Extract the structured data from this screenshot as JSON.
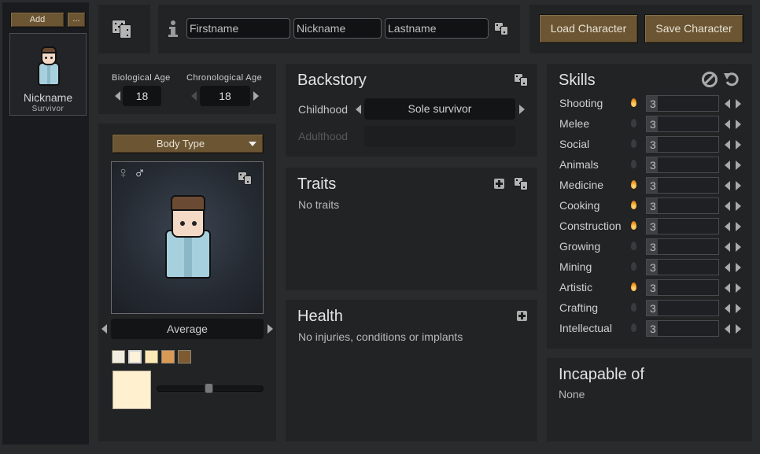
{
  "sidebar": {
    "add_label": "Add",
    "more_label": "...",
    "pawn": {
      "nickname": "Nickname",
      "title": "Survivor"
    }
  },
  "name": {
    "first_placeholder": "Firstname",
    "nick_placeholder": "Nickname",
    "last_placeholder": "Lastname"
  },
  "io": {
    "load_label": "Load Character",
    "save_label": "Save Character"
  },
  "age": {
    "biological_label": "Biological Age",
    "biological_value": "18",
    "chronological_label": "Chronological Age",
    "chronological_value": "18"
  },
  "appearance": {
    "body_type_label": "Body Type",
    "gender_female": "♀",
    "gender_male": "♂",
    "hair_style": "Average",
    "skin_swatches": [
      "#f1ece0",
      "#fdf1d9",
      "#fde9b6",
      "#d99a55",
      "#7e5a33"
    ],
    "selected_swatch": 1,
    "skin_color": "#fff0cf",
    "skin_slider_fraction": 0.48
  },
  "backstory": {
    "title": "Backstory",
    "childhood_label": "Childhood",
    "childhood_value": "Sole survivor",
    "adulthood_label": "Adulthood",
    "adulthood_value": ""
  },
  "traits": {
    "title": "Traits",
    "empty_text": "No traits"
  },
  "health": {
    "title": "Health",
    "empty_text": "No injuries, conditions or implants"
  },
  "skills": {
    "title": "Skills",
    "max_level": 20,
    "items": [
      {
        "name": "Shooting",
        "level": "3",
        "passion": true
      },
      {
        "name": "Melee",
        "level": "3",
        "passion": false
      },
      {
        "name": "Social",
        "level": "3",
        "passion": false
      },
      {
        "name": "Animals",
        "level": "3",
        "passion": false
      },
      {
        "name": "Medicine",
        "level": "3",
        "passion": true
      },
      {
        "name": "Cooking",
        "level": "3",
        "passion": true
      },
      {
        "name": "Construction",
        "level": "3",
        "passion": true
      },
      {
        "name": "Growing",
        "level": "3",
        "passion": false
      },
      {
        "name": "Mining",
        "level": "3",
        "passion": false
      },
      {
        "name": "Artistic",
        "level": "3",
        "passion": true
      },
      {
        "name": "Crafting",
        "level": "3",
        "passion": false
      },
      {
        "name": "Intellectual",
        "level": "3",
        "passion": false
      }
    ]
  },
  "incapable": {
    "title": "Incapable of",
    "value": "None"
  }
}
